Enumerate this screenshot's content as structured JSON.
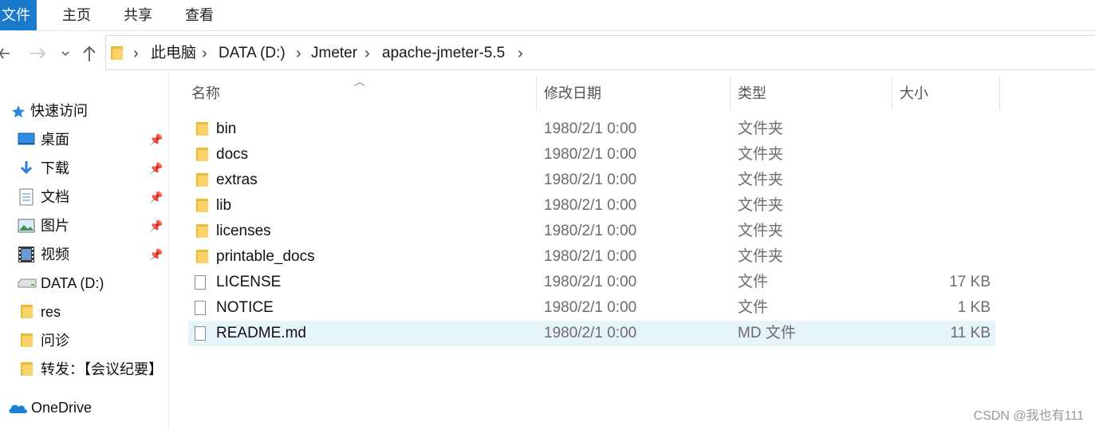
{
  "ribbon": {
    "tabs": [
      "文件",
      "主页",
      "共享",
      "查看"
    ]
  },
  "nav": {
    "back_icon": "back-arrow-icon",
    "forward_icon": "forward-arrow-icon",
    "history_icon": "chevron-down-icon",
    "up_icon": "up-arrow-icon",
    "breadcrumb": [
      "此电脑",
      "DATA (D:)",
      "Jmeter",
      "apache-jmeter-5.5"
    ]
  },
  "sidebar": {
    "quick_access": "快速访问",
    "items": [
      {
        "label": "桌面",
        "icon": "desktop-icon",
        "pinned": true
      },
      {
        "label": "下载",
        "icon": "download-icon",
        "pinned": true
      },
      {
        "label": "文档",
        "icon": "document-icon",
        "pinned": true
      },
      {
        "label": "图片",
        "icon": "picture-icon",
        "pinned": true
      },
      {
        "label": "视频",
        "icon": "video-icon",
        "pinned": true
      },
      {
        "label": "DATA (D:)",
        "icon": "drive-icon",
        "pinned": false
      },
      {
        "label": "res",
        "icon": "folder-icon",
        "pinned": false
      },
      {
        "label": "问诊",
        "icon": "folder-icon",
        "pinned": false
      },
      {
        "label": "转发：【会议纪要】",
        "icon": "folder-icon",
        "pinned": false
      }
    ],
    "onedrive": "OneDrive"
  },
  "columns": {
    "name": "名称",
    "date": "修改日期",
    "type": "类型",
    "size": "大小"
  },
  "files": [
    {
      "name": "bin",
      "date": "1980/2/1 0:00",
      "type": "文件夹",
      "size": "",
      "kind": "folder"
    },
    {
      "name": "docs",
      "date": "1980/2/1 0:00",
      "type": "文件夹",
      "size": "",
      "kind": "folder"
    },
    {
      "name": "extras",
      "date": "1980/2/1 0:00",
      "type": "文件夹",
      "size": "",
      "kind": "folder"
    },
    {
      "name": "lib",
      "date": "1980/2/1 0:00",
      "type": "文件夹",
      "size": "",
      "kind": "folder"
    },
    {
      "name": "licenses",
      "date": "1980/2/1 0:00",
      "type": "文件夹",
      "size": "",
      "kind": "folder"
    },
    {
      "name": "printable_docs",
      "date": "1980/2/1 0:00",
      "type": "文件夹",
      "size": "",
      "kind": "folder"
    },
    {
      "name": "LICENSE",
      "date": "1980/2/1 0:00",
      "type": "文件",
      "size": "17 KB",
      "kind": "file"
    },
    {
      "name": "NOTICE",
      "date": "1980/2/1 0:00",
      "type": "文件",
      "size": "1 KB",
      "kind": "file"
    },
    {
      "name": "README.md",
      "date": "1980/2/1 0:00",
      "type": "MD 文件",
      "size": "11 KB",
      "kind": "file",
      "selected": true
    }
  ],
  "watermark": "CSDN @我也有111"
}
